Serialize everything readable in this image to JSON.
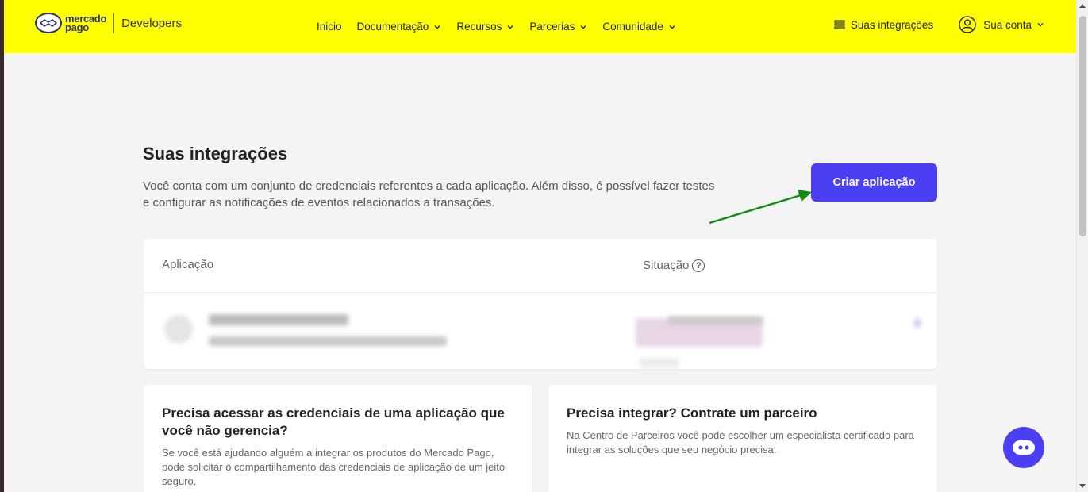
{
  "header": {
    "logo_line1": "mercado",
    "logo_line2": "pago",
    "logo_suffix": "Developers",
    "nav": [
      {
        "label": "Inicio",
        "has_dropdown": false
      },
      {
        "label": "Documentação",
        "has_dropdown": true
      },
      {
        "label": "Recursos",
        "has_dropdown": true
      },
      {
        "label": "Parcerias",
        "has_dropdown": true
      },
      {
        "label": "Comunidade",
        "has_dropdown": true
      }
    ],
    "integrations_label": "Suas integrações",
    "account_label": "Sua conta",
    "background": "#ffff00"
  },
  "main": {
    "title": "Suas integrações",
    "description": "Você conta com um conjunto de credenciais referentes a cada aplicação. Além disso, é possível fazer testes e configurar as notificações de eventos relacionados a transações.",
    "create_button": "Criar aplicação",
    "accent": "#4a3ff2",
    "annotation_color": "#138a13"
  },
  "table": {
    "col_app": "Aplicação",
    "col_status": "Situação",
    "help_glyph": "?"
  },
  "cards": {
    "left": {
      "title": "Precisa acessar as credenciais de uma aplicação que você não gerencia?",
      "body": "Se você está ajudando alguém a integrar os produtos do Mercado Pago, pode solicitar o compartilhamento das credenciais de aplicação de um jeito seguro."
    },
    "right": {
      "title": "Precisa integrar? Contrate um parceiro",
      "body": "Na Centro de Parceiros você pode escolher um especialista certificado para integrar as soluções que seu negócio precisa."
    }
  }
}
